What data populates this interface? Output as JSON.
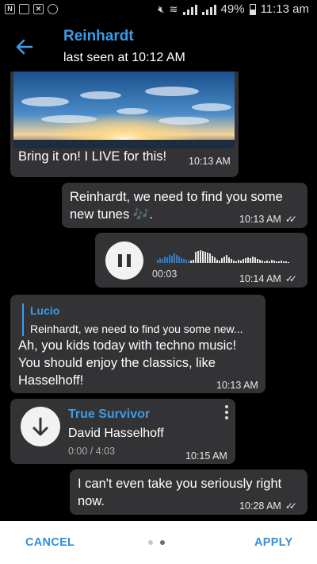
{
  "status_bar": {
    "battery": "49%",
    "time": "11:13 am"
  },
  "header": {
    "title": "Reinhardt",
    "subtitle": "last seen at 10:12 AM"
  },
  "messages": {
    "photo_msg": {
      "text": "Bring it on! I LIVE for this!",
      "time": "10:13 AM"
    },
    "msg_tunes": {
      "text_line1": "Reinhardt, we need to find you some",
      "text_line2": "new tunes 🎶.",
      "time": "10:13 AM"
    },
    "voice": {
      "duration": "00:03",
      "time": "10:14 AM"
    },
    "reply": {
      "quote_name": "Lucio",
      "quote_text": "Reinhardt, we need to find you some new...",
      "line1": "Ah, you kids today with techno music!",
      "line2": "You should enjoy the classics, like",
      "line3": "Hasselhoff!",
      "time": "10:13 AM"
    },
    "audio": {
      "title": "True Survivor",
      "artist": "David Hasselhoff",
      "duration": "0:00 / 4:03",
      "time": "10:15 AM"
    },
    "last": {
      "line1": "I can't even take you seriously right",
      "line2": "now.",
      "time": "10:28 AM"
    }
  },
  "bottom_bar": {
    "cancel": "CANCEL",
    "apply": "APPLY",
    "page_count": 2,
    "active_page": 2
  },
  "colors": {
    "accent": "#3b9cea",
    "bubble": "#333336",
    "background": "#000000"
  }
}
